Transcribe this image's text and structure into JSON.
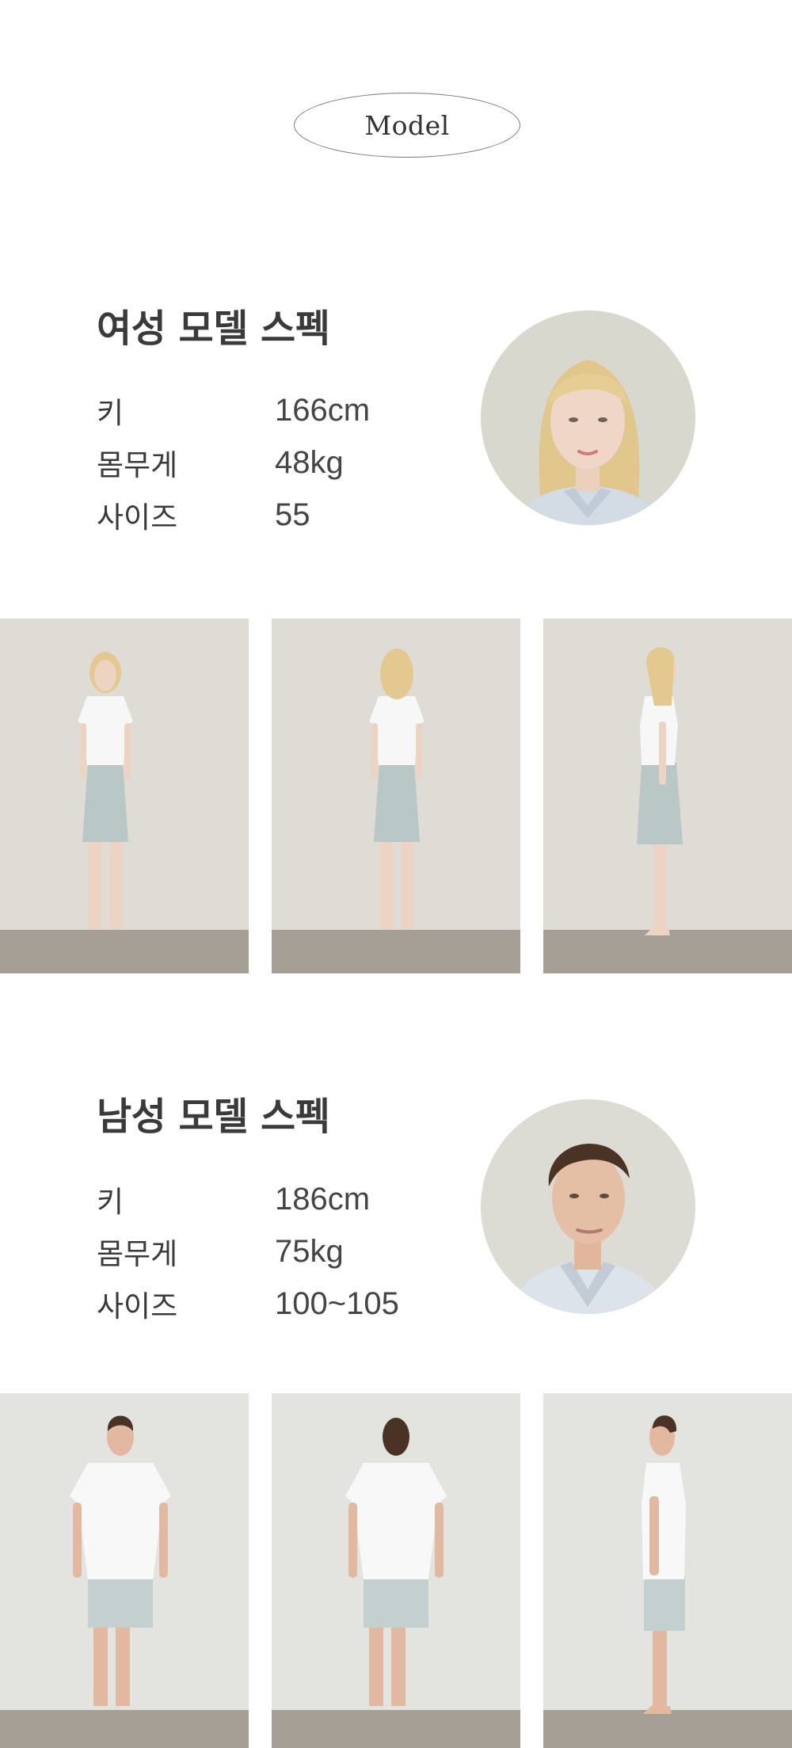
{
  "header": {
    "badge_label": "Model"
  },
  "female": {
    "title": "여성 모델 스펙",
    "specs": [
      {
        "label": "키",
        "value": "166cm"
      },
      {
        "label": "몸무게",
        "value": "48kg"
      },
      {
        "label": "사이즈",
        "value": "55"
      }
    ],
    "photos": [
      "front",
      "back",
      "side"
    ],
    "colors": {
      "hair": "#e3c98f",
      "skin": "#ecd3c2",
      "top": "#f7f7f7",
      "shorts": "#b9c8c7",
      "wall": "#dedcd5",
      "floor": "#a59f96"
    }
  },
  "male": {
    "title": "남성 모델 스펙",
    "specs": [
      {
        "label": "키",
        "value": "186cm"
      },
      {
        "label": "몸무게",
        "value": "75kg"
      },
      {
        "label": "사이즈",
        "value": "100~105"
      }
    ],
    "photos": [
      "front",
      "back",
      "side"
    ],
    "colors": {
      "hair": "#4a3324",
      "skin": "#e2b9a0",
      "top": "#f8f8f8",
      "shorts": "#c4cfd0",
      "wall": "#e3e3df",
      "floor": "#a59f96"
    }
  }
}
